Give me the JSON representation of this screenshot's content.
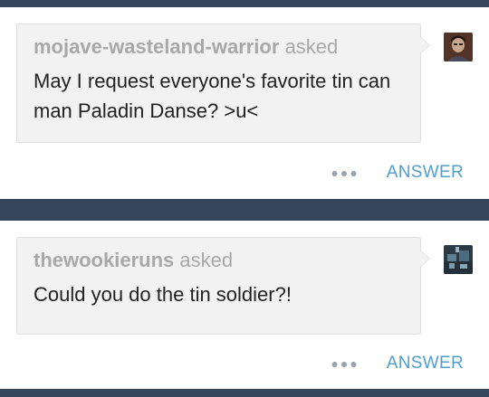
{
  "colors": {
    "dashboard_bg": "#36465d",
    "bubble_bg": "#f2f2f2",
    "muted_text": "#a8a8a8",
    "body_text": "#222222",
    "accent": "#529ecc"
  },
  "posts": [
    {
      "asker": "mojave-wasteland-warrior",
      "asked_label": "asked",
      "question": "May I request everyone's favorite tin can man Paladin Danse? >u<",
      "more_icon": "ellipsis-icon",
      "answer_label": "ANSWER"
    },
    {
      "asker": "thewookieruns",
      "asked_label": "asked",
      "question": "Could you do the tin soldier?!",
      "more_icon": "ellipsis-icon",
      "answer_label": "ANSWER"
    }
  ]
}
